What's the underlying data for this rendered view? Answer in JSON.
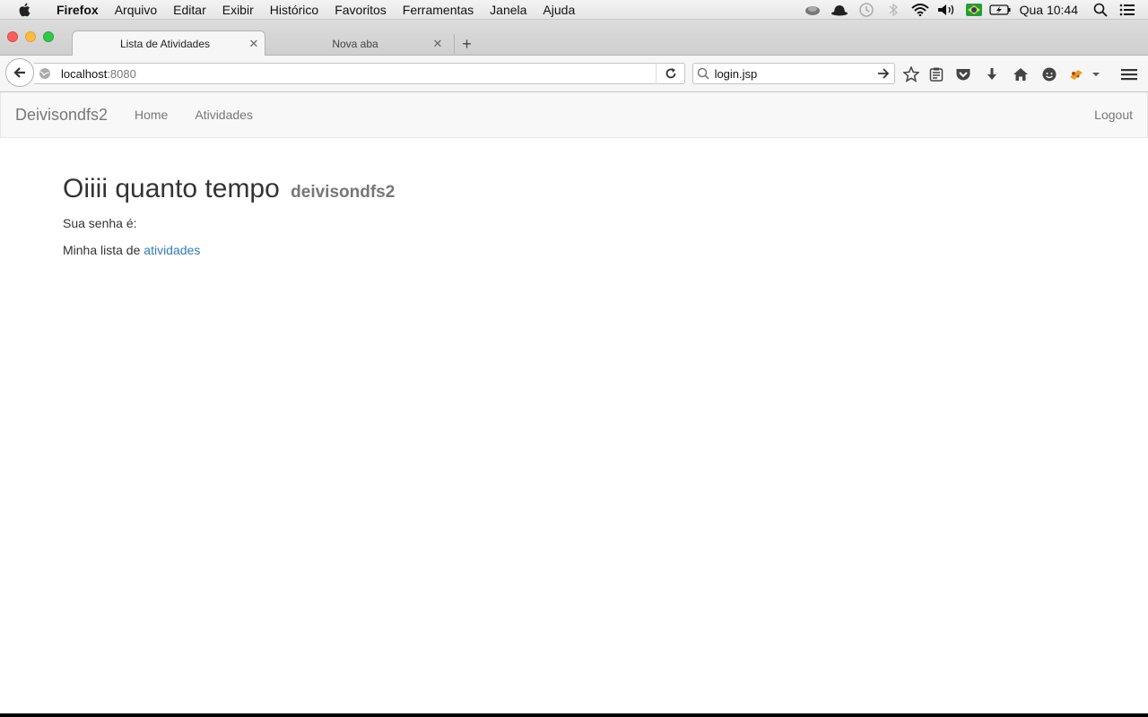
{
  "menubar": {
    "app_name": "Firefox",
    "items": [
      "Arquivo",
      "Editar",
      "Exibir",
      "Histórico",
      "Favoritos",
      "Ferramentas",
      "Janela",
      "Ajuda"
    ],
    "clock": "Qua 10:44"
  },
  "tabs": [
    {
      "title": "Lista de Atividades",
      "active": true
    },
    {
      "title": "Nova aba",
      "active": false
    }
  ],
  "toolbar": {
    "url_host": "localhost",
    "url_port": ":8080",
    "search_value": "login.jsp"
  },
  "site_nav": {
    "brand": "Deivisondfs2",
    "links": [
      "Home",
      "Atividades"
    ],
    "logout": "Logout"
  },
  "content": {
    "heading": "Oiiii quanto tempo",
    "username": "deivisondfs2",
    "password_label": "Sua senha é:",
    "list_prefix": "Minha lista de",
    "list_link": "atividades"
  },
  "colors": {
    "link": "#337ab7",
    "nav_bg": "#f8f8f8"
  }
}
